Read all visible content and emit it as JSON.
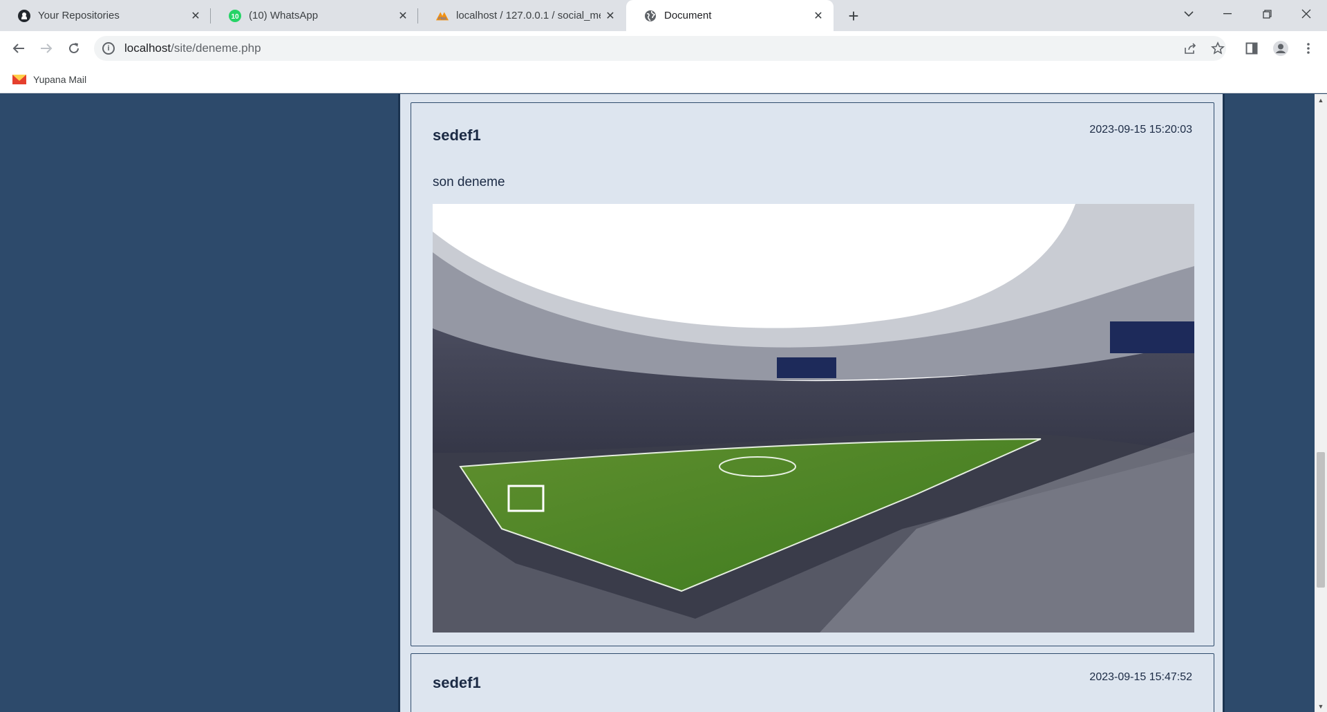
{
  "tabs": [
    {
      "title": "Your Repositories",
      "icon": "github-icon"
    },
    {
      "title": "(10) WhatsApp",
      "icon": "whatsapp-icon",
      "badge": "10"
    },
    {
      "title": "localhost / 127.0.0.1 / social_media",
      "icon": "phpmyadmin-icon"
    },
    {
      "title": "Document",
      "icon": "globe-icon",
      "active": true
    }
  ],
  "address": {
    "host": "localhost",
    "path": "/site/deneme.php"
  },
  "bookmarks": [
    {
      "label": "Yupana Mail",
      "icon": "mail-icon"
    }
  ],
  "posts": [
    {
      "author": "sedef1",
      "date": "2023-09-15 15:20:03",
      "text": "son deneme",
      "image": "stadium-photo"
    },
    {
      "author": "sedef1",
      "date": "2023-09-15 15:47:52"
    }
  ],
  "colors": {
    "page_bg": "#2d4a6b",
    "card_bg": "#dde5ef",
    "text": "#1b2a44"
  }
}
